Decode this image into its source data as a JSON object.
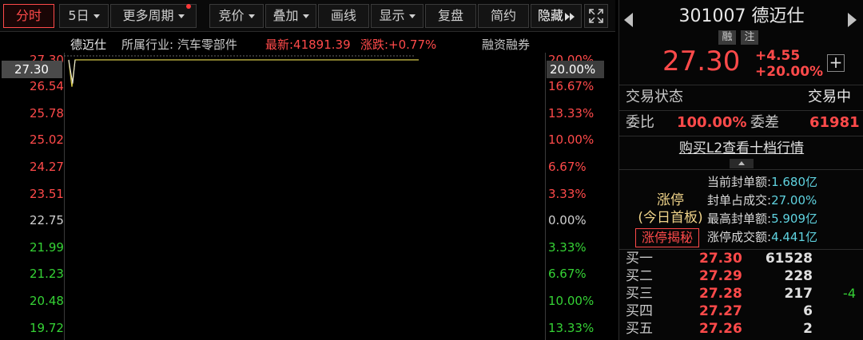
{
  "toolbar": {
    "timeshare": "分时",
    "five_day": "5日",
    "more_periods": "更多周期",
    "auction": "竞价",
    "overlay": "叠加",
    "draw_line": "画线",
    "display": "显示",
    "replay": "复盘",
    "simple": "简约",
    "hide": "隐藏"
  },
  "info_bar": {
    "stock_name": "德迈仕",
    "industry": "所属行业: 汽车零部件",
    "latest": "最新:41891.39",
    "change": "涨跌:+0.77%",
    "margin": "融资融券"
  },
  "chart": {
    "current_price_tag": "27.30",
    "current_pct_tag": "20.00%",
    "left_ticks": [
      "27.30",
      "26.54",
      "25.78",
      "25.02",
      "24.27",
      "23.51",
      "22.75",
      "21.99",
      "21.23",
      "20.48",
      "19.72"
    ],
    "right_ticks": [
      "20.00%",
      "16.67%",
      "13.33%",
      "10.00%",
      "6.67%",
      "3.33%",
      "0.00%",
      "3.33%",
      "6.67%",
      "10.00%",
      "13.33%"
    ],
    "colors": {
      "up": "#ff4a4a",
      "down": "#35d235",
      "price_line": "#d6c94a",
      "avg_line": "#e8e8e8"
    }
  },
  "chart_data": {
    "type": "line",
    "title": "",
    "xlabel": "",
    "ylabel": "",
    "ylim": [
      19.72,
      27.3
    ],
    "series": [
      {
        "values": [
          27.3,
          26.54,
          27.3,
          27.3,
          27.3,
          27.3,
          27.3,
          27.3,
          27.3,
          27.3,
          27.3,
          27.3,
          27.3
        ]
      }
    ]
  },
  "quote": {
    "code": "301007",
    "name": "德迈仕",
    "badge_margin": "融",
    "badge_note": "注",
    "price": "27.30",
    "change": "+4.55",
    "change_pct": "+20.00%",
    "status_label": "交易状态",
    "status_value": "交易中",
    "commit_ratio_label": "委比",
    "commit_ratio_value": "100.00%",
    "commit_diff_label": "委差",
    "commit_diff_value": "61981",
    "l2_link": "购买L2查看十档行情"
  },
  "limit_up": {
    "title": "涨停",
    "subtitle": "(今日首板)",
    "reveal_button": "涨停揭秘",
    "items": [
      {
        "label": "当前封单额:",
        "value": "1.680亿"
      },
      {
        "label": "封单占成交:",
        "value": "27.00%"
      },
      {
        "label": "最高封单额:",
        "value": "5.909亿"
      },
      {
        "label": "涨停成交额:",
        "value": "4.441亿"
      }
    ]
  },
  "order_book": {
    "bids": [
      {
        "label": "买一",
        "price": "27.30",
        "volume": "61528",
        "change": ""
      },
      {
        "label": "买二",
        "price": "27.29",
        "volume": "228",
        "change": ""
      },
      {
        "label": "买三",
        "price": "27.28",
        "volume": "217",
        "change": "-4"
      },
      {
        "label": "买四",
        "price": "27.27",
        "volume": "6",
        "change": ""
      },
      {
        "label": "买五",
        "price": "27.26",
        "volume": "2",
        "change": ""
      }
    ]
  }
}
